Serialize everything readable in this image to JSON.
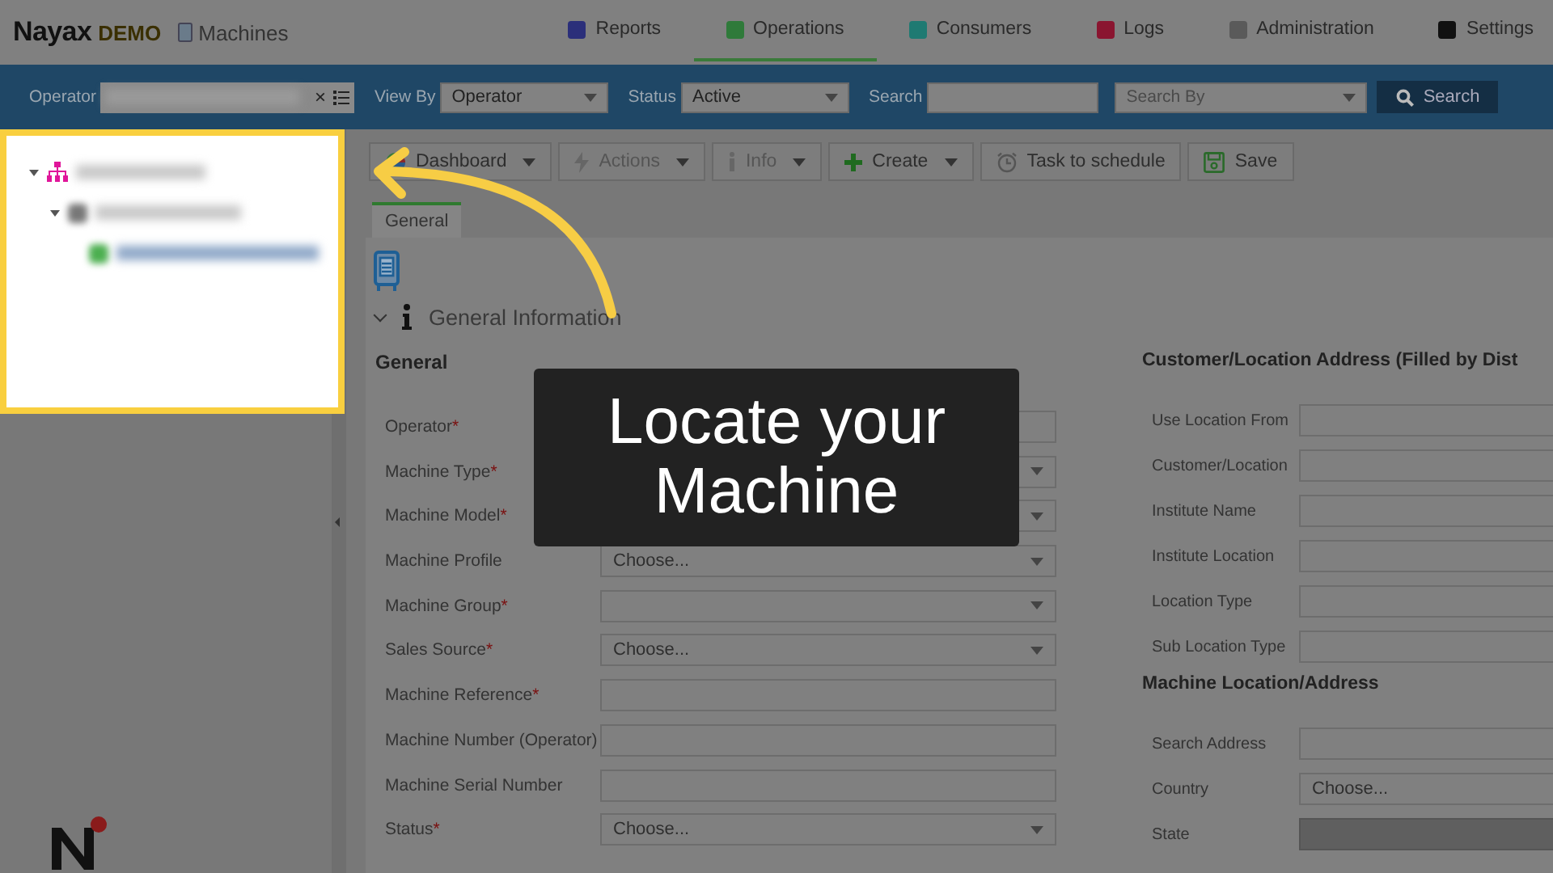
{
  "header": {
    "logo": "Nayax",
    "logo_suffix": "DEMO",
    "page_title": "Machines"
  },
  "nav": [
    {
      "label": "Reports",
      "color": "#2b2f7a",
      "selected": false
    },
    {
      "label": "Operations",
      "color": "#2f7a3a",
      "selected": true
    },
    {
      "label": "Consumers",
      "color": "#1f7a72",
      "selected": false
    },
    {
      "label": "Logs",
      "color": "#8a1530",
      "selected": false
    },
    {
      "label": "Administration",
      "color": "#5a5a5a",
      "selected": false
    },
    {
      "label": "Settings",
      "color": "#111111",
      "selected": false
    }
  ],
  "filters": {
    "operator_label": "Operator",
    "clear_symbol": "×",
    "view_by_label": "View By",
    "view_by": "Operator",
    "status_label": "Status",
    "status": "Active",
    "search_label": "Search",
    "search_by_placeholder": "Search By",
    "search_button": "Search"
  },
  "tree": [
    {
      "kind": "organization",
      "expanded": true,
      "children": [
        {
          "kind": "operator",
          "expanded": true,
          "children": [
            {
              "kind": "machine"
            }
          ]
        }
      ]
    }
  ],
  "toolbar": [
    {
      "kind": "dashboard",
      "label": "Dashboard",
      "dropdown": true,
      "disabled": false
    },
    {
      "kind": "actions",
      "label": "Actions",
      "dropdown": true,
      "disabled": true
    },
    {
      "kind": "info",
      "label": "Info",
      "dropdown": true,
      "disabled": true
    },
    {
      "kind": "create",
      "label": "Create",
      "dropdown": true,
      "disabled": false
    },
    {
      "kind": "task",
      "label": "Task to schedule",
      "dropdown": false,
      "disabled": false
    },
    {
      "kind": "save",
      "label": "Save",
      "dropdown": false,
      "disabled": false
    }
  ],
  "tabs": [
    {
      "label": "General",
      "selected": true
    }
  ],
  "section": {
    "title": "General Information",
    "expanded": true
  },
  "general": {
    "title": "General",
    "fields": [
      {
        "label": "Operator",
        "required_mark": "*",
        "kind": "lookup"
      },
      {
        "label": "Machine Type",
        "required_mark": "*",
        "kind": "select"
      },
      {
        "label": "Machine Model",
        "required_mark": "*",
        "kind": "select"
      },
      {
        "label": "Machine Profile",
        "kind": "select",
        "value": "Choose..."
      },
      {
        "label": "Machine Group",
        "required_mark": "*",
        "kind": "select"
      },
      {
        "label": "Sales Source",
        "required_mark": "*",
        "kind": "select",
        "value": "Choose..."
      },
      {
        "label": "Machine Reference",
        "required_mark": "*",
        "kind": "input"
      },
      {
        "label": "Machine Number (Operator)",
        "kind": "input"
      },
      {
        "label": "Machine Serial Number",
        "kind": "input"
      },
      {
        "label": "Status",
        "required_mark": "*",
        "kind": "select",
        "value": "Choose..."
      }
    ]
  },
  "customer": {
    "title": "Customer/Location Address (Filled by Dist",
    "fields": [
      {
        "label": "Use Location From",
        "disabled": false
      },
      {
        "label": "Customer/Location",
        "disabled": false
      },
      {
        "label": "Institute Name",
        "disabled": false
      },
      {
        "label": "Institute Location",
        "disabled": false
      },
      {
        "label": "Location Type",
        "disabled": false
      },
      {
        "label": "Sub Location Type",
        "disabled": false
      }
    ]
  },
  "machine_location": {
    "title": "Machine Location/Address",
    "fields": [
      {
        "label": "Search Address",
        "disabled": false
      },
      {
        "label": "Country",
        "value": "Choose...",
        "disabled": false
      },
      {
        "label": "State",
        "disabled": true
      }
    ]
  },
  "caption": {
    "lines": [
      "Locate your",
      "Machine"
    ]
  }
}
